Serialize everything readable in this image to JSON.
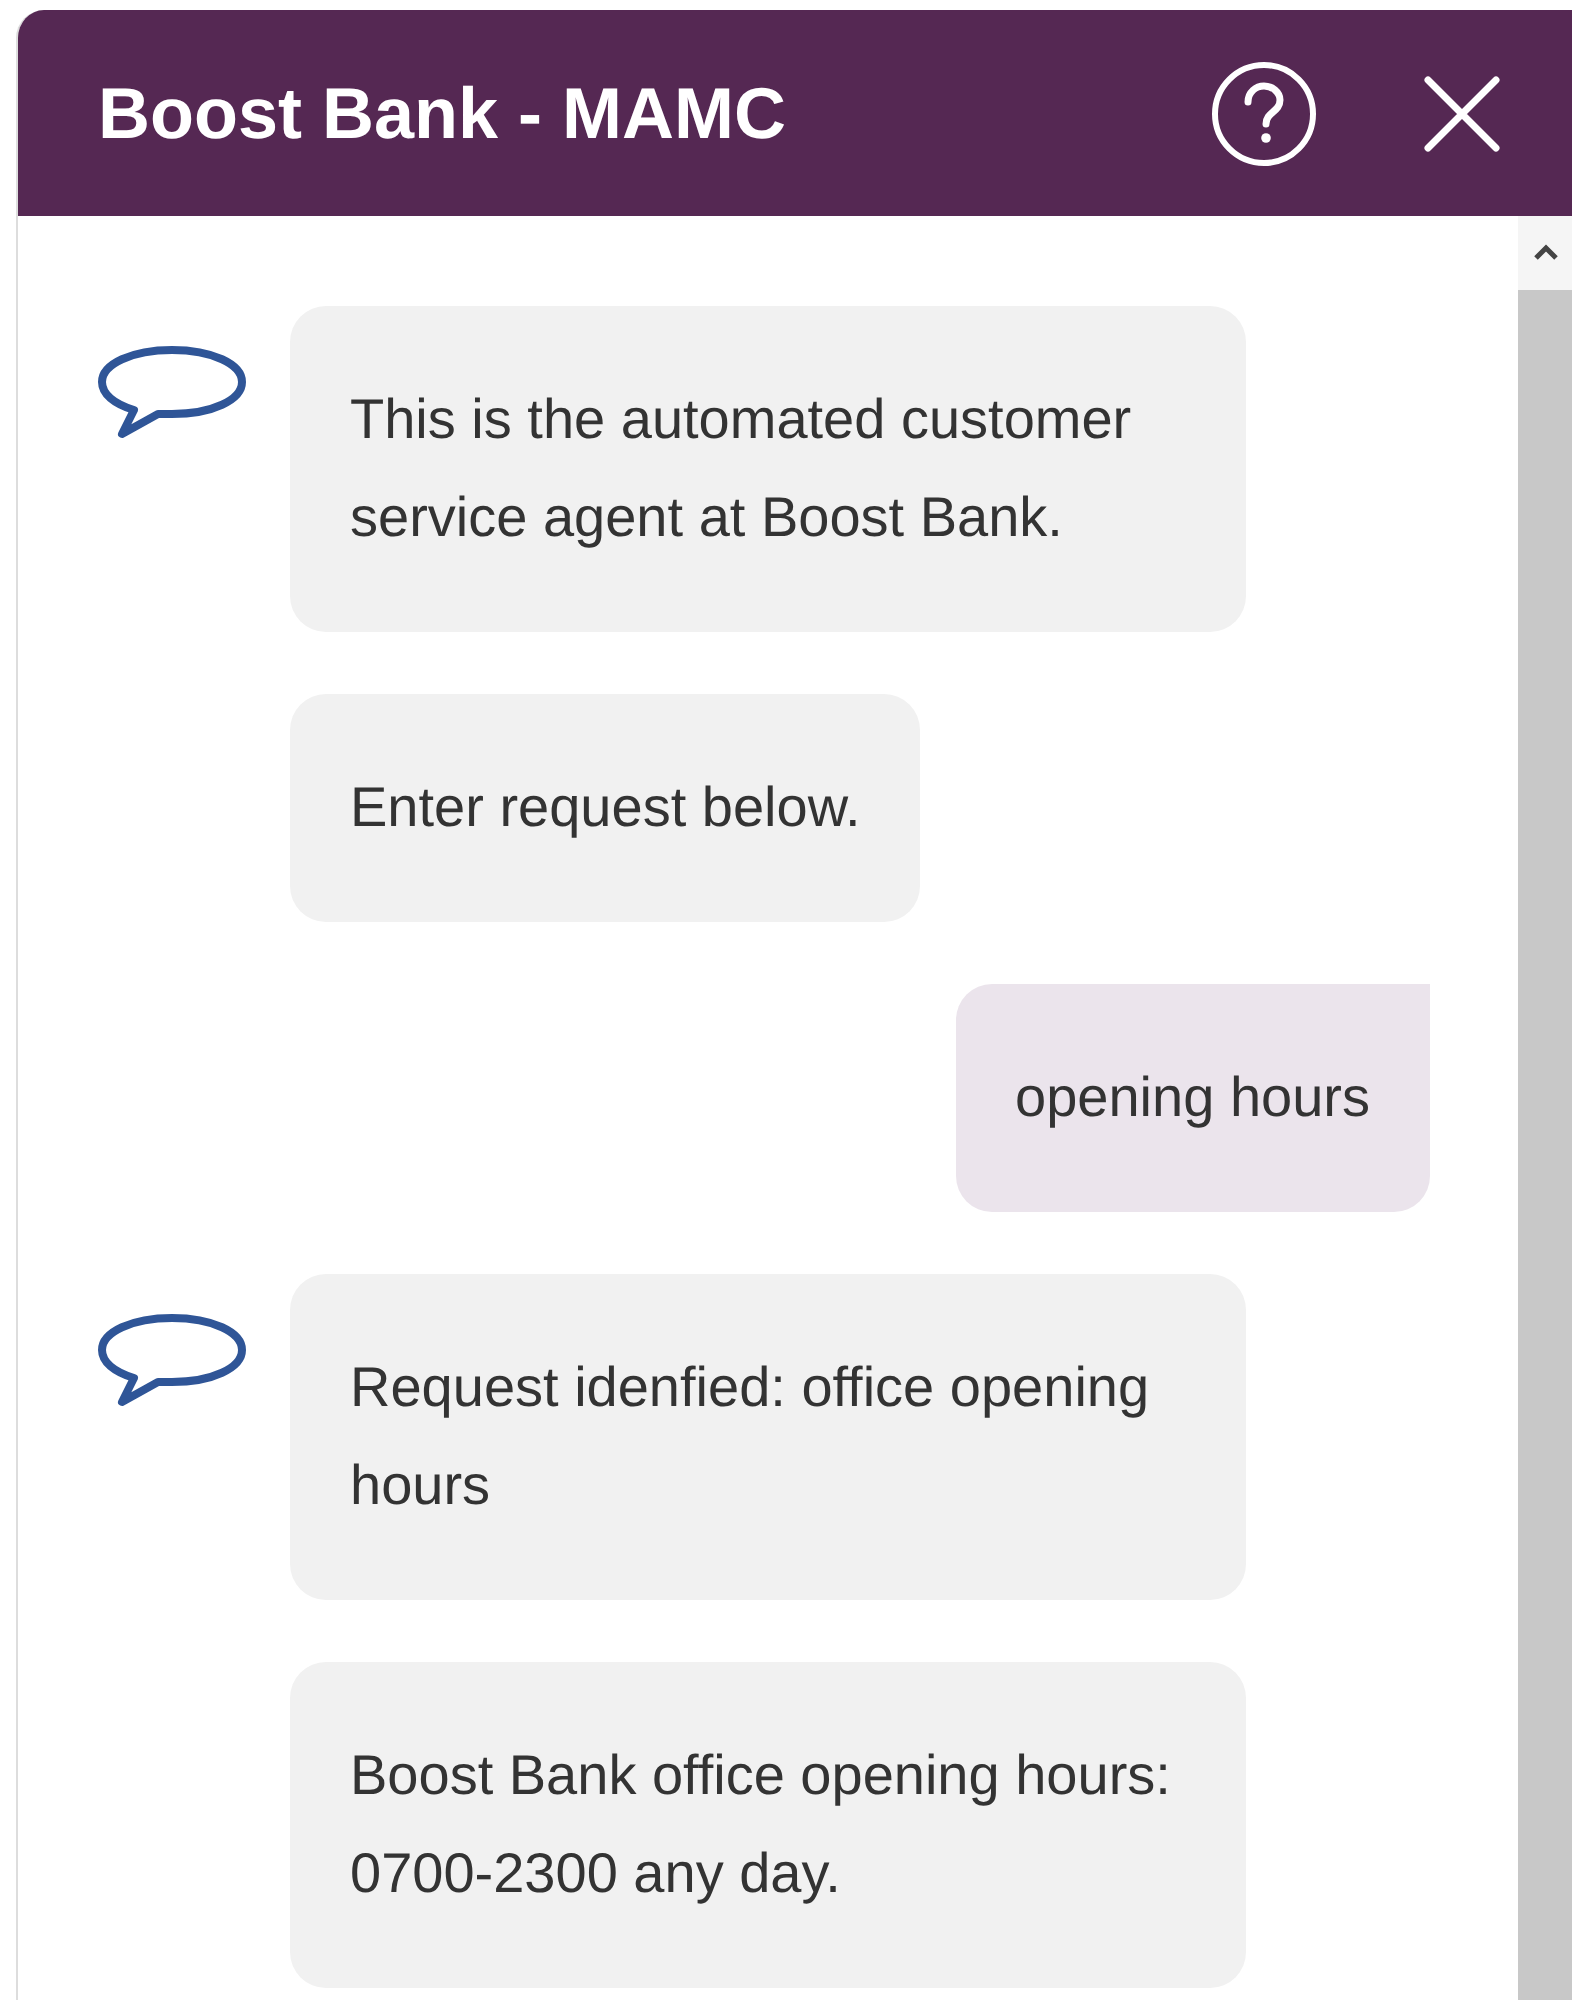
{
  "window": {
    "title": "Boost Bank - MAMC"
  },
  "conversation": [
    {
      "kind": "bot",
      "messages": [
        "This is the automated customer service agent at Boost Bank.",
        "Enter request below."
      ]
    },
    {
      "kind": "user",
      "messages": [
        "opening hours"
      ]
    },
    {
      "kind": "bot",
      "messages": [
        "Request idenfied: office opening hours",
        "Boost Bank office opening hours: 0700-2300 any day."
      ]
    }
  ]
}
